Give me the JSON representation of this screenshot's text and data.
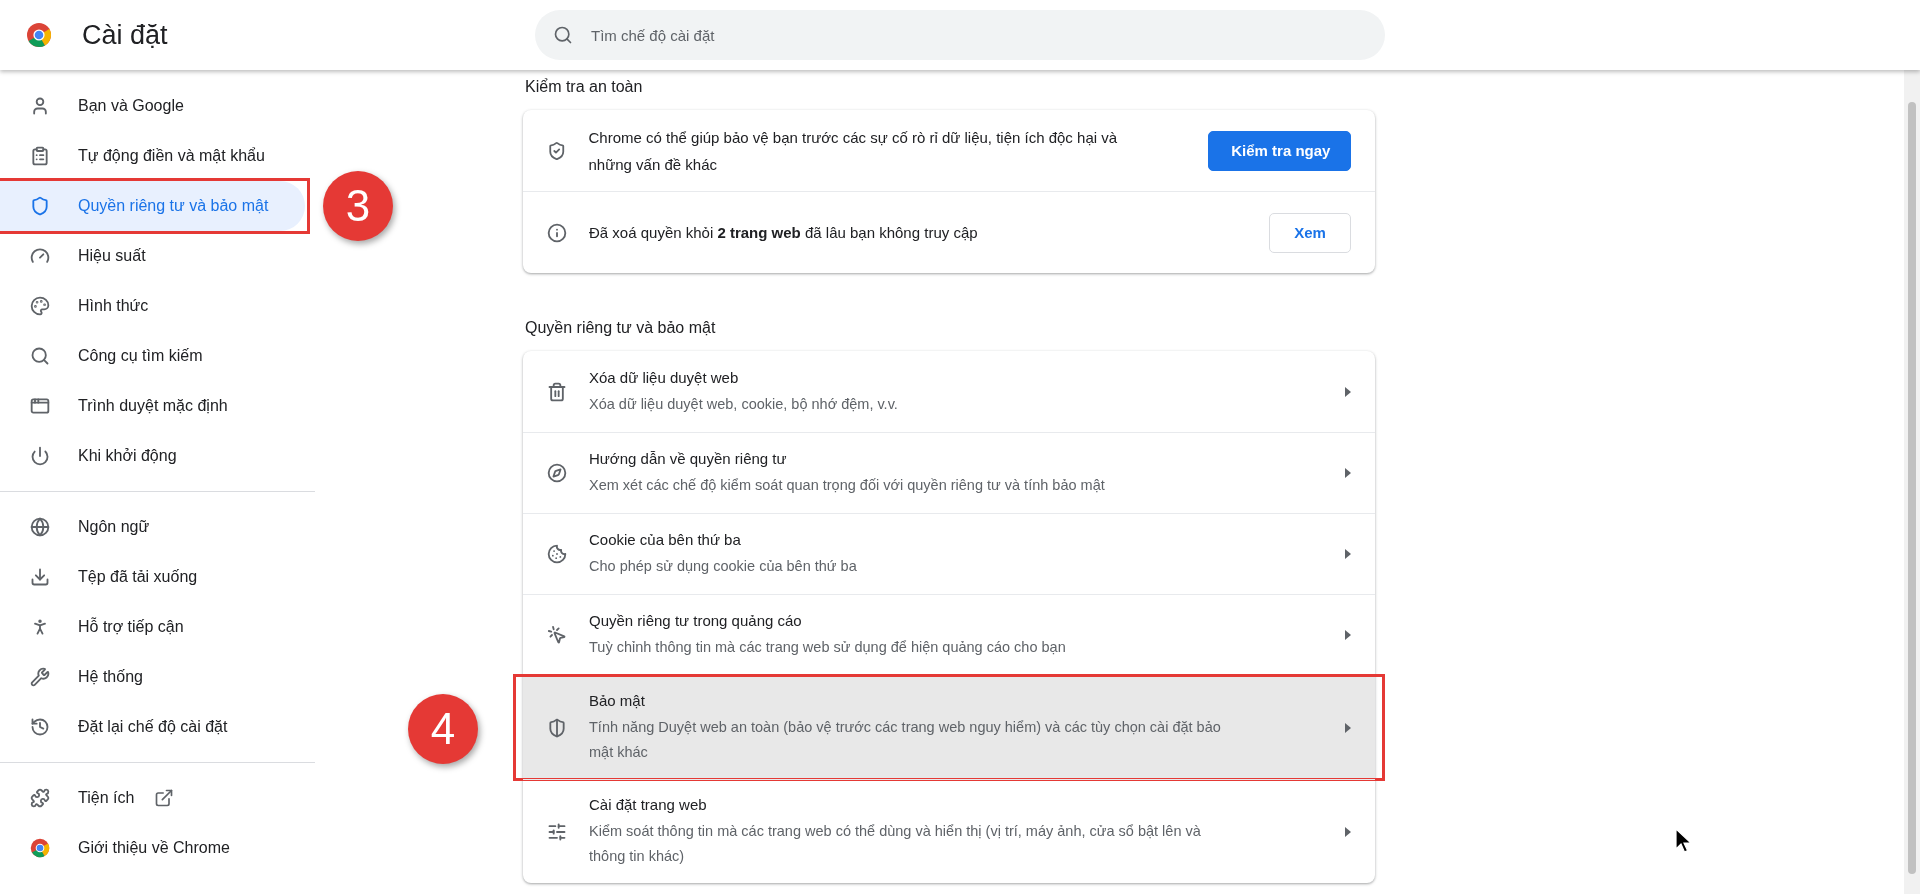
{
  "header": {
    "title": "Cài đặt",
    "search": {
      "placeholder": "Tìm chế độ cài đặt"
    }
  },
  "sidebar": {
    "groups": [
      {
        "items": [
          {
            "label": "Bạn và Google",
            "selected": false
          },
          {
            "label": "Tự động điền và mật khẩu",
            "selected": false
          },
          {
            "label": "Quyền riêng tư và bảo mật",
            "selected": true,
            "outlined": true,
            "callout": "3"
          },
          {
            "label": "Hiệu suất",
            "selected": false
          },
          {
            "label": "Hình thức",
            "selected": false
          },
          {
            "label": "Công cụ tìm kiếm",
            "selected": false
          },
          {
            "label": "Trình duyệt mặc định",
            "selected": false
          },
          {
            "label": "Khi khởi động",
            "selected": false
          }
        ]
      },
      {
        "items": [
          {
            "label": "Ngôn ngữ",
            "selected": false
          },
          {
            "label": "Tệp đã tải xuống",
            "selected": false
          },
          {
            "label": "Hỗ trợ tiếp cận",
            "selected": false
          },
          {
            "label": "Hệ thống",
            "selected": false
          },
          {
            "label": "Đặt lại chế độ cài đặt",
            "selected": false
          }
        ]
      },
      {
        "items": [
          {
            "label": "Tiện ích",
            "selected": false,
            "external": true
          },
          {
            "label": "Giới thiệu về Chrome",
            "selected": false
          }
        ]
      }
    ]
  },
  "safety_check": {
    "title": "Kiểm tra an toàn",
    "rows": [
      {
        "text": "Chrome có thể giúp bảo vệ bạn trước các sự cố rò rỉ dữ liệu, tiện ích độc hại và những vấn đề khác",
        "button": "Kiểm tra ngay",
        "primary": true
      },
      {
        "text": "Đã xoá quyền khỏi **2 trang web** đã lâu bạn không truy cập",
        "button": "Xem",
        "primary": false
      }
    ]
  },
  "privacy": {
    "title": "Quyền riêng tư và bảo mật",
    "rows": [
      {
        "title": "Xóa dữ liệu duyệt web",
        "subtitle": "Xóa dữ liệu duyệt web, cookie, bộ nhớ đệm, v.v.",
        "hovered": false
      },
      {
        "title": "Hướng dẫn về quyền riêng tư",
        "subtitle": "Xem xét các chế độ kiểm soát quan trọng đối với quyền riêng tư và tính bảo mật",
        "hovered": false
      },
      {
        "title": "Cookie của bên thứ ba",
        "subtitle": "Cho phép sử dụng cookie của bên thứ ba",
        "hovered": false
      },
      {
        "title": "Quyền riêng tư trong quảng cáo",
        "subtitle": "Tuỳ chỉnh thông tin mà các trang web sử dụng để hiện quảng cáo cho bạn",
        "hovered": false
      },
      {
        "title": "Bảo mật",
        "subtitle": "Tính năng Duyệt web an toàn (bảo vệ trước các trang web nguy hiểm) và các tùy chọn cài đặt bảo mật khác",
        "hovered": true,
        "outlined": true,
        "callout": "4"
      },
      {
        "title": "Cài đặt trang web",
        "subtitle": "Kiểm soát thông tin mà các trang web có thể dùng và hiển thị (vị trí, máy ảnh, cửa sổ bật lên và thông tin khác)",
        "hovered": false
      }
    ]
  }
}
